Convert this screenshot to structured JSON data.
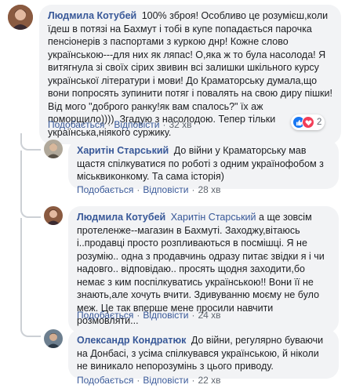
{
  "comments": [
    {
      "author": "Людмила Котубей",
      "text": "100% зброя! Особливо це розумієш,коли їдеш в потязі на Бахмут і тобі в купе попадається парочка пенсіонерів з паспортами з куркою днр! Кожне слово українською---для них як ляпас! О,яка ж то була насолода! Я витягнула зі своїх сірих звивин всі залишки шкільного курсу української літератури і мови! До Краматорську думала,що вони попросять зупинити потяг і повалять на свою диру пішки! Від мого \"доброго ранку!як вам спалось?\" їх аж поморщило)))). Згадую з насолодою. Тепер тільки українська,ніякого суржику.",
      "like": "Подобається",
      "reply": "Відповісти",
      "time": "32 хв",
      "reactions_count": "2",
      "reaction_colors": [
        "#1877f2",
        "#f33e58"
      ]
    },
    {
      "author": "Харитін Старський",
      "text": "До війни у Краматорську мав щастя спілкуватися по роботі з одним українофобом з міськвиконкому. Та сама історія)",
      "like": "Подобається",
      "reply": "Відповісти",
      "time": "28 хв"
    },
    {
      "author": "Людмила Котубей",
      "mention": "Харитін Старський",
      "text": "а ще зовсім протеленже--магазин в Бахмуті. Заходжу,вітаюсь і..продавці просто розпливаються в посмішці. Я не розумію.. одна з продавчинь одразу питає звідки я і чи надовго.. відповідаю.. просять щодня заходити,бо немає з ким поспілкуватись українською!! Вони її не знають,але хочуть вчити. Здивуванню моєму не було меж. Це так вперше мене просили навчити розмовляти...",
      "like": "Подобається",
      "reply": "Відповісти",
      "time": "24 хв"
    },
    {
      "author": "Олександр Кондратюк",
      "text": "До війни, регулярно буваючи на Донбасі, з усіма спілкувався українською, й ніколи не виникало непорозумінь з цього приводу.",
      "like": "Подобається",
      "reply": "Відповісти",
      "time": "22 хв"
    }
  ]
}
